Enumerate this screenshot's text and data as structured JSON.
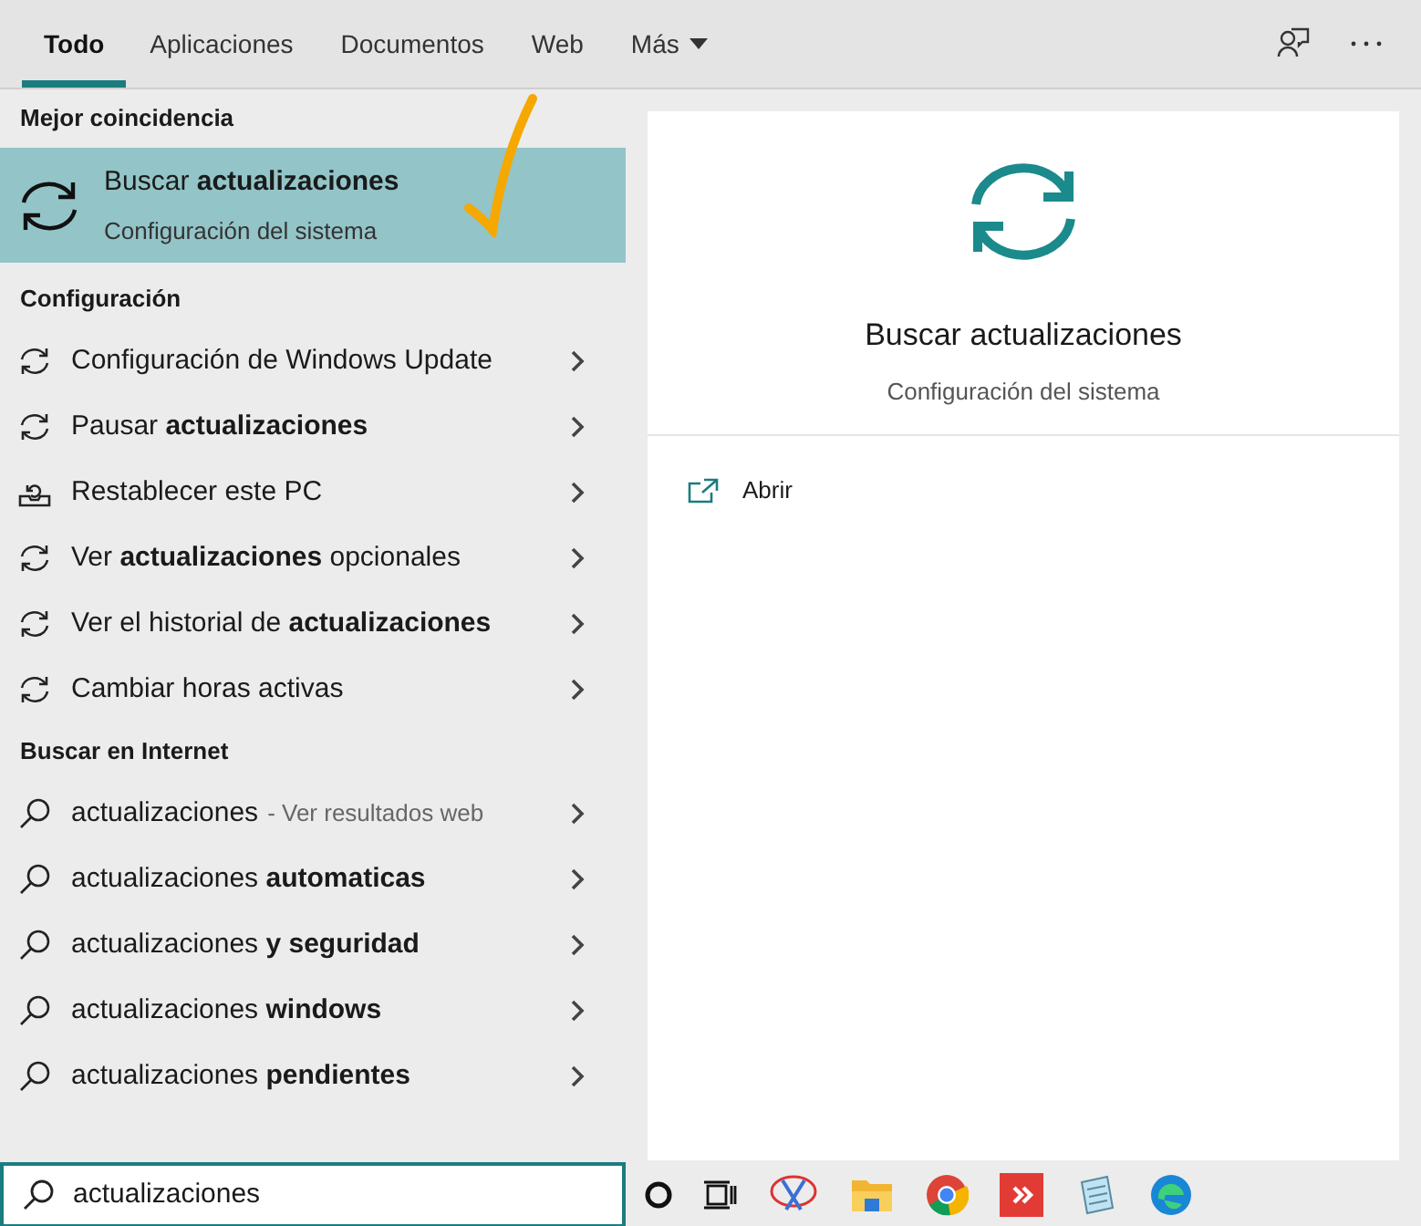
{
  "tabs": [
    {
      "label": "Todo",
      "selected": true
    },
    {
      "label": "Aplicaciones",
      "selected": false
    },
    {
      "label": "Documentos",
      "selected": false
    },
    {
      "label": "Web",
      "selected": false
    },
    {
      "label": "Más",
      "selected": false,
      "dropdown": true
    }
  ],
  "best_match": {
    "heading": "Mejor coincidencia",
    "title": "Buscar **actualizaciones**",
    "subtitle": "Configuración del sistema",
    "selected": true
  },
  "settings": {
    "heading": "Configuración",
    "items": [
      {
        "label": "Configuración de Windows Update",
        "kind": "sync"
      },
      {
        "label": "Pausar **actualizaciones**",
        "kind": "sync"
      },
      {
        "label": "Restablecer este PC",
        "kind": "reset"
      },
      {
        "label": "Ver **actualizaciones** opcionales",
        "kind": "sync"
      },
      {
        "label": "Ver el historial de **actualizaciones**",
        "kind": "sync"
      },
      {
        "label": "Cambiar horas activas",
        "kind": "sync"
      }
    ]
  },
  "web": {
    "heading": "Buscar en Internet",
    "items": [
      {
        "label": "actualizaciones",
        "suffix": "- Ver resultados web"
      },
      {
        "label": "actualizaciones **automaticas**"
      },
      {
        "label": "actualizaciones **y seguridad**"
      },
      {
        "label": "actualizaciones **windows**"
      },
      {
        "label": "actualizaciones **pendientes**"
      }
    ]
  },
  "preview": {
    "title": "Buscar actualizaciones",
    "subtitle": "Configuración del sistema",
    "actions": [
      "Abrir"
    ]
  },
  "search": {
    "value": "actualizaciones"
  }
}
